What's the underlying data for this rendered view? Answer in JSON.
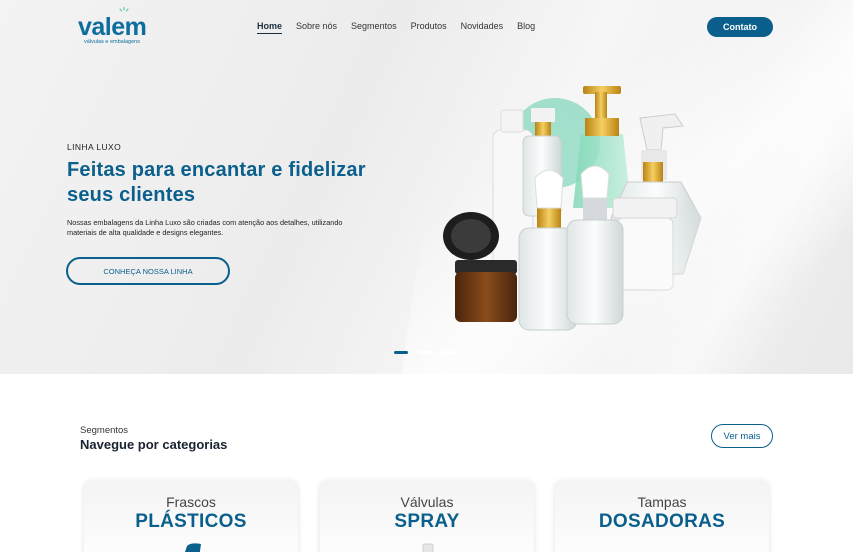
{
  "header": {
    "logo_word": "valem",
    "logo_tagline": "válvulas e embalagens",
    "nav": [
      {
        "label": "Home",
        "active": true
      },
      {
        "label": "Sobre nós",
        "active": false
      },
      {
        "label": "Segmentos",
        "active": false
      },
      {
        "label": "Produtos",
        "active": false
      },
      {
        "label": "Novidades",
        "active": false
      },
      {
        "label": "Blog",
        "active": false
      }
    ],
    "contact_label": "Contato"
  },
  "hero": {
    "eyebrow": "LINHA LUXO",
    "title": "Feitas para encantar e fidelizar seus clientes",
    "description": "Nossas embalagens da Linha Luxo são criadas com atenção aos detalhes, utilizando materiais de alta qualidade e designs elegantes.",
    "cta_label": "CONHEÇA NOSSA LINHA",
    "slides_total": 3,
    "slide_active": 1
  },
  "segments": {
    "eyebrow": "Segmentos",
    "title": "Navegue por categorias",
    "more_label": "Ver mais",
    "cards": [
      {
        "small": "Frascos",
        "big": "PLÁSTICOS"
      },
      {
        "small": "Válvulas",
        "big": "SPRAY"
      },
      {
        "small": "Tampas",
        "big": "DOSADORAS"
      }
    ]
  },
  "colors": {
    "brand": "#0b5f8c",
    "accent_green": "#3cc49a",
    "gold": "#d9a21e",
    "amber_glass": "#6b3a16"
  }
}
